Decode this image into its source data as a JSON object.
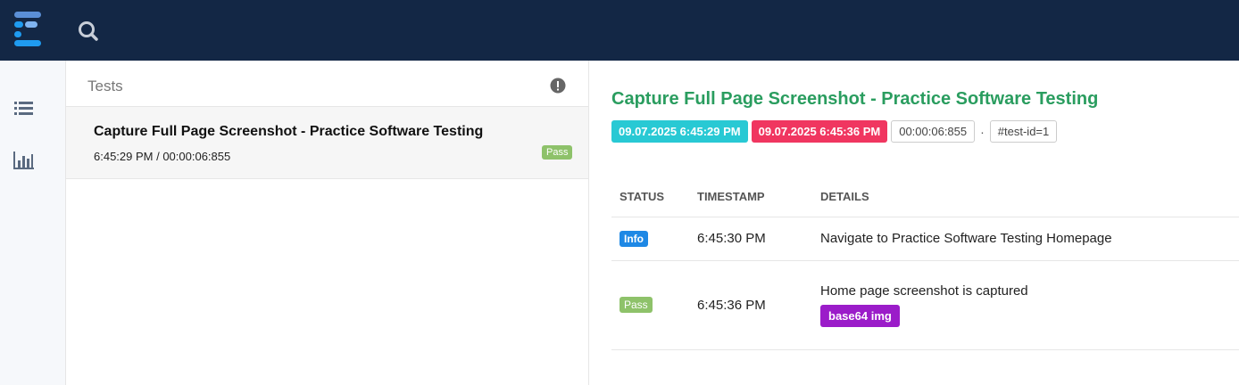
{
  "topbar": {
    "logo_icon": "extent-logo-icon",
    "search_icon": "search-icon"
  },
  "sidenav": {
    "items": [
      {
        "icon": "list-icon"
      },
      {
        "icon": "bar-chart-icon"
      }
    ]
  },
  "test_list": {
    "header": "Tests",
    "alert_icon": "exclamation-circle-icon",
    "tests": [
      {
        "name": "Capture Full Page Screenshot - Practice Software Testing",
        "meta": "6:45:29 PM / 00:00:06:855",
        "status": "Pass"
      }
    ]
  },
  "detail": {
    "title": "Capture Full Page Screenshot - Practice Software Testing",
    "start_time": "09.07.2025 6:45:29 PM",
    "end_time": "09.07.2025 6:45:36 PM",
    "duration": "00:00:06:855",
    "separator": "·",
    "test_id": "#test-id=1",
    "table": {
      "headers": {
        "status": "STATUS",
        "timestamp": "TIMESTAMP",
        "details": "DETAILS"
      },
      "rows": [
        {
          "status": "Info",
          "timestamp": "6:45:30 PM",
          "details": "Navigate to Practice Software Testing Homepage"
        },
        {
          "status": "Pass",
          "timestamp": "6:45:36 PM",
          "details": "Home page screenshot is captured",
          "attachment": "base64 img"
        }
      ]
    }
  },
  "colors": {
    "topbar": "#132745",
    "title_green": "#2a9d5f",
    "start_badge": "#28c9d4",
    "end_badge": "#f03660",
    "pass": "#8ec26a",
    "info": "#1e88e5",
    "img_badge": "#9b1cc9"
  }
}
